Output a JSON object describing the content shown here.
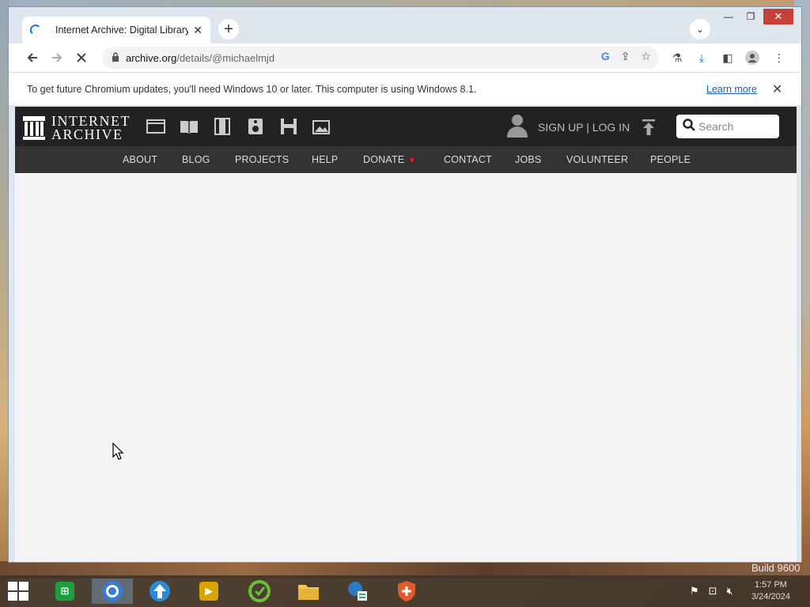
{
  "browser": {
    "tab_title": "Internet Archive: Digital Library o",
    "tab_close": "✕",
    "new_tab": "+",
    "tab_search": "⌄",
    "url_host": "archive.org",
    "url_path": "/details/@michaelmjd",
    "window_controls": {
      "minimize": "—",
      "maximize": "❐",
      "close": "✕"
    }
  },
  "infobar": {
    "message": "To get future Chromium updates, you'll need Windows 10 or later. This computer is using Windows 8.1.",
    "learn_more": "Learn more",
    "close": "✕"
  },
  "ia_header": {
    "logo_line1": "INTERNET",
    "logo_line2": "ARCHIVE",
    "media_icons": [
      "web-icon",
      "texts-icon",
      "video-icon",
      "audio-icon",
      "software-icon",
      "images-icon"
    ],
    "signup_login": "SIGN UP | LOG IN",
    "search_placeholder": "Search"
  },
  "ia_nav": {
    "items": [
      "ABOUT",
      "BLOG",
      "PROJECTS",
      "HELP",
      "DONATE",
      "CONTACT",
      "JOBS",
      "VOLUNTEER",
      "PEOPLE"
    ]
  },
  "desktop": {
    "watermark": "Build 9600",
    "clock_time": "1:57 PM",
    "clock_date": "3/24/2024"
  },
  "taskbar": {
    "apps": [
      "store-app",
      "chrome-app",
      "upload-app",
      "media-player-app",
      "ccleaner-app",
      "file-explorer-app",
      "network-app",
      "security-app"
    ]
  },
  "colors": {
    "ia_header": "#222222",
    "ia_nav": "#333333",
    "donate_heart": "#e0212b",
    "close_button": "#c7413b"
  }
}
